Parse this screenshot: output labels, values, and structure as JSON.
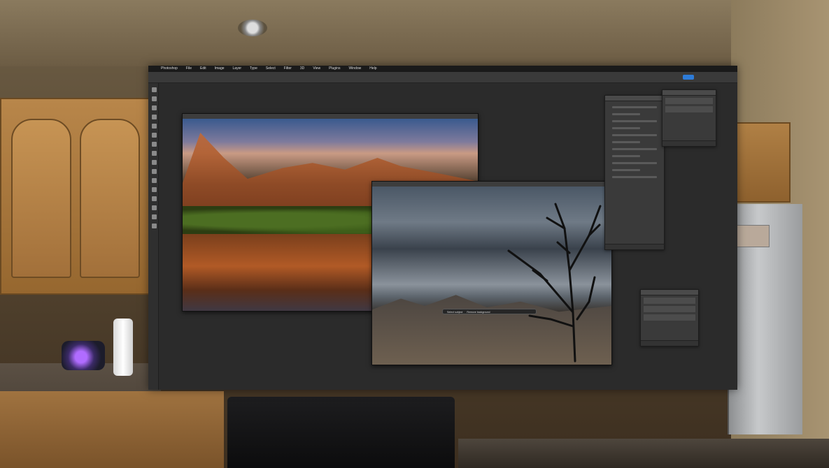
{
  "app": {
    "name": "Photoshop",
    "menu_items": [
      "Photoshop",
      "File",
      "Edit",
      "Image",
      "Layer",
      "Type",
      "Select",
      "Filter",
      "3D",
      "View",
      "Plugins",
      "Window",
      "Help"
    ],
    "accent_color": "#2d7bd8"
  },
  "documents": [
    {
      "id": "canyon-lake",
      "title": ""
    },
    {
      "id": "storm-tree",
      "title": ""
    }
  ],
  "contextual_task_bar": {
    "buttons": [
      "Select subject",
      "Remove background"
    ]
  },
  "properties_panel": {
    "title": ""
  },
  "layers_panel": {
    "layers": [
      "",
      ""
    ]
  },
  "adjustments_panel": {
    "rows": [
      "",
      "",
      ""
    ]
  },
  "scene": {
    "environment": "",
    "icons": [
      "ceiling-light-icon",
      "lamp-icon"
    ]
  }
}
